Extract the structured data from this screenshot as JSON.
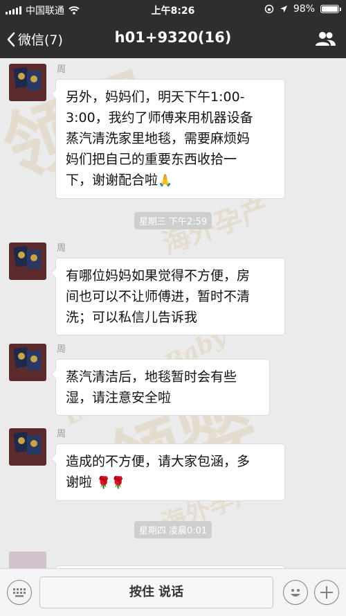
{
  "status_bar": {
    "carrier": "中国联通",
    "time": "上午8:26",
    "battery": "98%",
    "battery_level": 0.98
  },
  "nav": {
    "back_label": "微信(7)",
    "title": "h01+9320(16)"
  },
  "watermarks": [
    "领婴",
    "海外孕产",
    "Leading Baby"
  ],
  "messages": [
    {
      "sender": "周",
      "lines": [
        "另外，妈妈们，明天下午1:00-",
        "3:00，我约了师傅来用机器设备",
        "蒸汽清洗家里地毯，需要麻烦妈",
        "妈们把自己的重要东西收拾一"
      ],
      "last_line": "下，谢谢配合啦",
      "emoji": "🙏"
    },
    {
      "sender": "周",
      "lines": [
        "有哪位妈妈如果觉得不方便，房",
        "间也可以不让师傅进，暂时不清",
        "洗；可以私信儿告诉我"
      ]
    },
    {
      "sender": "周",
      "lines": [
        "蒸汽清洁后，地毯暂时会有些",
        "湿，请注意安全啦"
      ]
    },
    {
      "sender": "周",
      "lines": [
        "造成的不方便，请大家包涵，多"
      ],
      "last_line": "谢啦",
      "emoji": "🌹🌹"
    }
  ],
  "timestamps": [
    "星期三 下午2:59",
    "星期四 凌晨0:01"
  ],
  "input_bar": {
    "hold_to_talk": "按住 说话"
  },
  "icons": {
    "back": "chevron-left-icon",
    "people": "group-icon",
    "keyboard": "keyboard-icon",
    "emoji": "emoji-icon",
    "plus": "plus-icon"
  }
}
